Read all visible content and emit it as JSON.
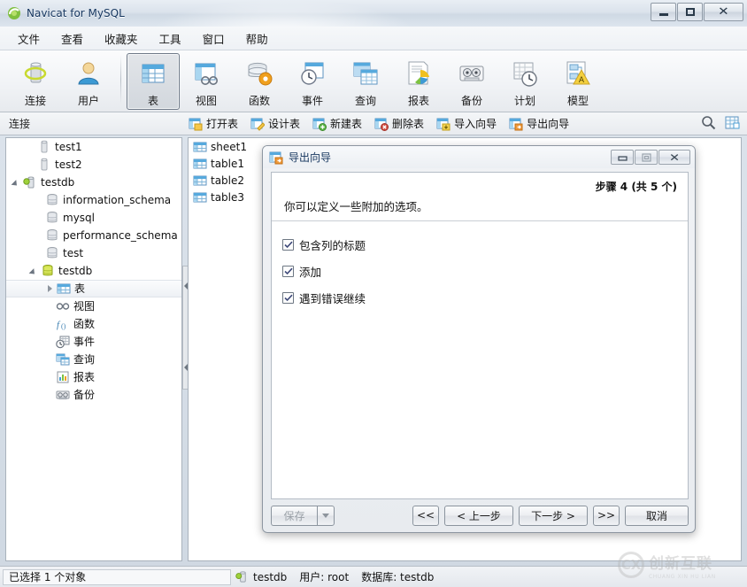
{
  "window": {
    "title": "Navicat for MySQL",
    "app_icon": "navicat-icon",
    "controls": {
      "minimize": "minimize-icon",
      "maximize": "maximize-icon",
      "close": "close-icon"
    }
  },
  "menubar": {
    "items": [
      {
        "label": "文件"
      },
      {
        "label": "查看"
      },
      {
        "label": "收藏夹"
      },
      {
        "label": "工具"
      },
      {
        "label": "窗口"
      },
      {
        "label": "帮助"
      }
    ]
  },
  "toolbar": {
    "items": [
      {
        "label": "连接",
        "icon": "connection-icon",
        "selected": false
      },
      {
        "label": "用户",
        "icon": "user-icon",
        "selected": false
      },
      {
        "label": "表",
        "icon": "table-icon",
        "selected": true
      },
      {
        "label": "视图",
        "icon": "view-icon",
        "selected": false
      },
      {
        "label": "函数",
        "icon": "function-icon",
        "selected": false
      },
      {
        "label": "事件",
        "icon": "event-icon",
        "selected": false
      },
      {
        "label": "查询",
        "icon": "query-icon",
        "selected": false
      },
      {
        "label": "报表",
        "icon": "report-icon",
        "selected": false
      },
      {
        "label": "备份",
        "icon": "backup-icon",
        "selected": false
      },
      {
        "label": "计划",
        "icon": "schedule-icon",
        "selected": false
      },
      {
        "label": "模型",
        "icon": "model-icon",
        "selected": false
      }
    ]
  },
  "subtoolbar": {
    "section_label": "连接",
    "buttons": [
      {
        "label": "打开表",
        "icon": "open-table-icon"
      },
      {
        "label": "设计表",
        "icon": "design-table-icon"
      },
      {
        "label": "新建表",
        "icon": "new-table-icon"
      },
      {
        "label": "删除表",
        "icon": "delete-table-icon"
      },
      {
        "label": "导入向导",
        "icon": "import-wizard-icon"
      },
      {
        "label": "导出向导",
        "icon": "export-wizard-icon"
      }
    ],
    "right_icons": [
      {
        "name": "search-icon"
      },
      {
        "name": "grid-view-icon"
      }
    ]
  },
  "tree": {
    "nodes": [
      {
        "label": "test1",
        "icon": "connection-gray-icon",
        "indent": 1,
        "expander": "none",
        "selected": false
      },
      {
        "label": "test2",
        "icon": "connection-gray-icon",
        "indent": 1,
        "expander": "none",
        "selected": false
      },
      {
        "label": "testdb",
        "icon": "connection-active-icon",
        "indent": 0,
        "expander": "open",
        "selected": false
      },
      {
        "label": "information_schema",
        "icon": "database-gray-icon",
        "indent": 2,
        "expander": "none",
        "selected": false
      },
      {
        "label": "mysql",
        "icon": "database-gray-icon",
        "indent": 2,
        "expander": "none",
        "selected": false
      },
      {
        "label": "performance_schema",
        "icon": "database-gray-icon",
        "indent": 2,
        "expander": "none",
        "selected": false
      },
      {
        "label": "test",
        "icon": "database-gray-icon",
        "indent": 2,
        "expander": "none",
        "selected": false
      },
      {
        "label": "testdb",
        "icon": "database-open-icon",
        "indent": 1,
        "expander": "open",
        "selected": false
      },
      {
        "label": "表",
        "icon": "table-icon",
        "indent": 3,
        "expander": "closed",
        "selected": true
      },
      {
        "label": "视图",
        "icon": "view-glasses-icon",
        "indent": 3,
        "expander": "none",
        "selected": false
      },
      {
        "label": "函数",
        "icon": "function-fx-icon",
        "indent": 3,
        "expander": "none",
        "selected": false
      },
      {
        "label": "事件",
        "icon": "event-icon",
        "indent": 3,
        "expander": "none",
        "selected": false
      },
      {
        "label": "查询",
        "icon": "query-icon",
        "indent": 3,
        "expander": "none",
        "selected": false
      },
      {
        "label": "报表",
        "icon": "report-icon",
        "indent": 3,
        "expander": "none",
        "selected": false
      },
      {
        "label": "备份",
        "icon": "backup-icon",
        "indent": 3,
        "expander": "none",
        "selected": false
      }
    ]
  },
  "object_list": {
    "items": [
      {
        "label": "sheet1",
        "icon": "table-icon"
      },
      {
        "label": "table1",
        "icon": "table-icon"
      },
      {
        "label": "table2",
        "icon": "table-icon"
      },
      {
        "label": "table3",
        "icon": "table-icon"
      }
    ]
  },
  "dialog": {
    "title": "导出向导",
    "icon": "export-wizard-icon",
    "controls": {
      "minimize": "minimize-icon",
      "maximize": "maximize-icon",
      "close": "close-icon"
    },
    "step_text": "步骤 4 (共 5 个)",
    "description": "你可以定义一些附加的选项。",
    "checkboxes": [
      {
        "label": "包含列的标题",
        "checked": true
      },
      {
        "label": "添加",
        "checked": true
      },
      {
        "label": "遇到错误继续",
        "checked": true
      }
    ],
    "buttons": {
      "save": "保存",
      "save_dropdown": "chevron-down-icon",
      "first": "<<",
      "prev": "< 上一步",
      "next": "下一步 >",
      "last": ">>",
      "cancel": "取消"
    }
  },
  "statusbar": {
    "selection": "已选择 1 个对象",
    "connection": "testdb",
    "connection_icon": "connection-active-icon",
    "user": "用户: root",
    "database": "数据库: testdb"
  },
  "watermark": {
    "mark": "CX",
    "cn": "创新互联",
    "en": "CHUANG XIN HU LIAN"
  },
  "colors": {
    "accent_blue": "#4a9fd4",
    "title_text": "#16365e",
    "chrome": "#e8ebef",
    "panel_bg": "#ffffff"
  }
}
